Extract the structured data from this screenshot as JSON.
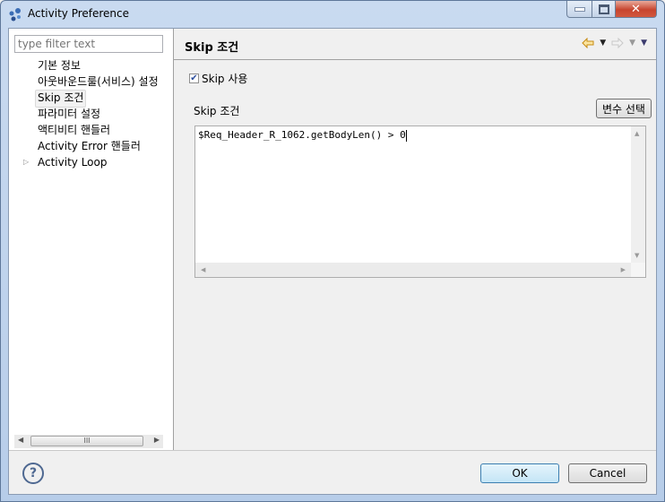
{
  "window": {
    "title": "Activity Preference",
    "controls": {
      "minimize": "minimize",
      "maximize": "maximize",
      "close": "close"
    }
  },
  "sidebar": {
    "filter_placeholder": "type filter text",
    "items": [
      {
        "label": "기본 정보",
        "selected": false
      },
      {
        "label": "아웃바운드룰(서비스) 설정",
        "selected": false
      },
      {
        "label": "Skip 조건",
        "selected": true
      },
      {
        "label": "파라미터 설정",
        "selected": false
      },
      {
        "label": "액티비티 핸들러",
        "selected": false
      },
      {
        "label": "Activity Error 핸들러",
        "selected": false
      },
      {
        "label": "Activity Loop",
        "selected": false,
        "expandable": true
      }
    ],
    "scroll_thumb_glyph": "III"
  },
  "page": {
    "title": "Skip 조건",
    "nav": {
      "back": "back-arrow",
      "back_menu": "dropdown",
      "forward": "forward-arrow",
      "forward_menu": "dropdown",
      "view_menu": "menu"
    },
    "skip_checkbox": {
      "label": "Skip 사용",
      "checked": true
    },
    "condition_label": "Skip 조건",
    "variable_button": "변수 선택",
    "condition_expression": "$Req_Header_R_1062.getBodyLen() > 0"
  },
  "footer": {
    "help_glyph": "?",
    "ok": "OK",
    "cancel": "Cancel"
  },
  "colors": {
    "accent_icon": "#e8b84a",
    "ok_border": "#3c7fb1",
    "close_button": "#c7452f"
  }
}
